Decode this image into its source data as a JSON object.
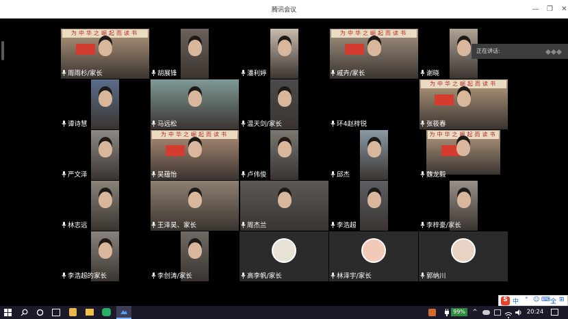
{
  "window": {
    "title": "腾讯会议",
    "min_glyph": "—",
    "max_glyph": "❐",
    "close_glyph": "✕"
  },
  "speaking": {
    "label": "正在讲话:"
  },
  "participants": [
    {
      "name": "周雨杉/家长"
    },
    {
      "name": "胡展锋"
    },
    {
      "name": "潘利婷"
    },
    {
      "name": "戚卉/家长"
    },
    {
      "name": "谢晓"
    },
    {
      "name": "谭诗慧"
    },
    {
      "name": "马远松"
    },
    {
      "name": "温天剑/家长"
    },
    {
      "name": "环4赵梓锐"
    },
    {
      "name": "张筱春"
    },
    {
      "name": "严文泽"
    },
    {
      "name": "吴蕴怡"
    },
    {
      "name": "卢伟俊"
    },
    {
      "name": "邱杰"
    },
    {
      "name": "魏龙毅"
    },
    {
      "name": "林志远"
    },
    {
      "name": "王泽昊、家长"
    },
    {
      "name": "周杰兰"
    },
    {
      "name": "李浩超"
    },
    {
      "name": "李梓豪/家长"
    },
    {
      "name": "李浩超的家长"
    },
    {
      "name": "李创涛/家长"
    },
    {
      "name": "高李帆/家长"
    },
    {
      "name": "林泽宇/家长"
    },
    {
      "name": "郭纳川"
    }
  ],
  "banner": {
    "text": "为中华之崛起而读书"
  },
  "taskbar": {
    "battery": "99%",
    "time": "20:24",
    "start_icon": "windows-logo-icon"
  },
  "ime": {
    "logo": "S",
    "mode": "中",
    "items": [
      "°",
      "☺",
      "⌨",
      "全",
      "⊞"
    ]
  }
}
